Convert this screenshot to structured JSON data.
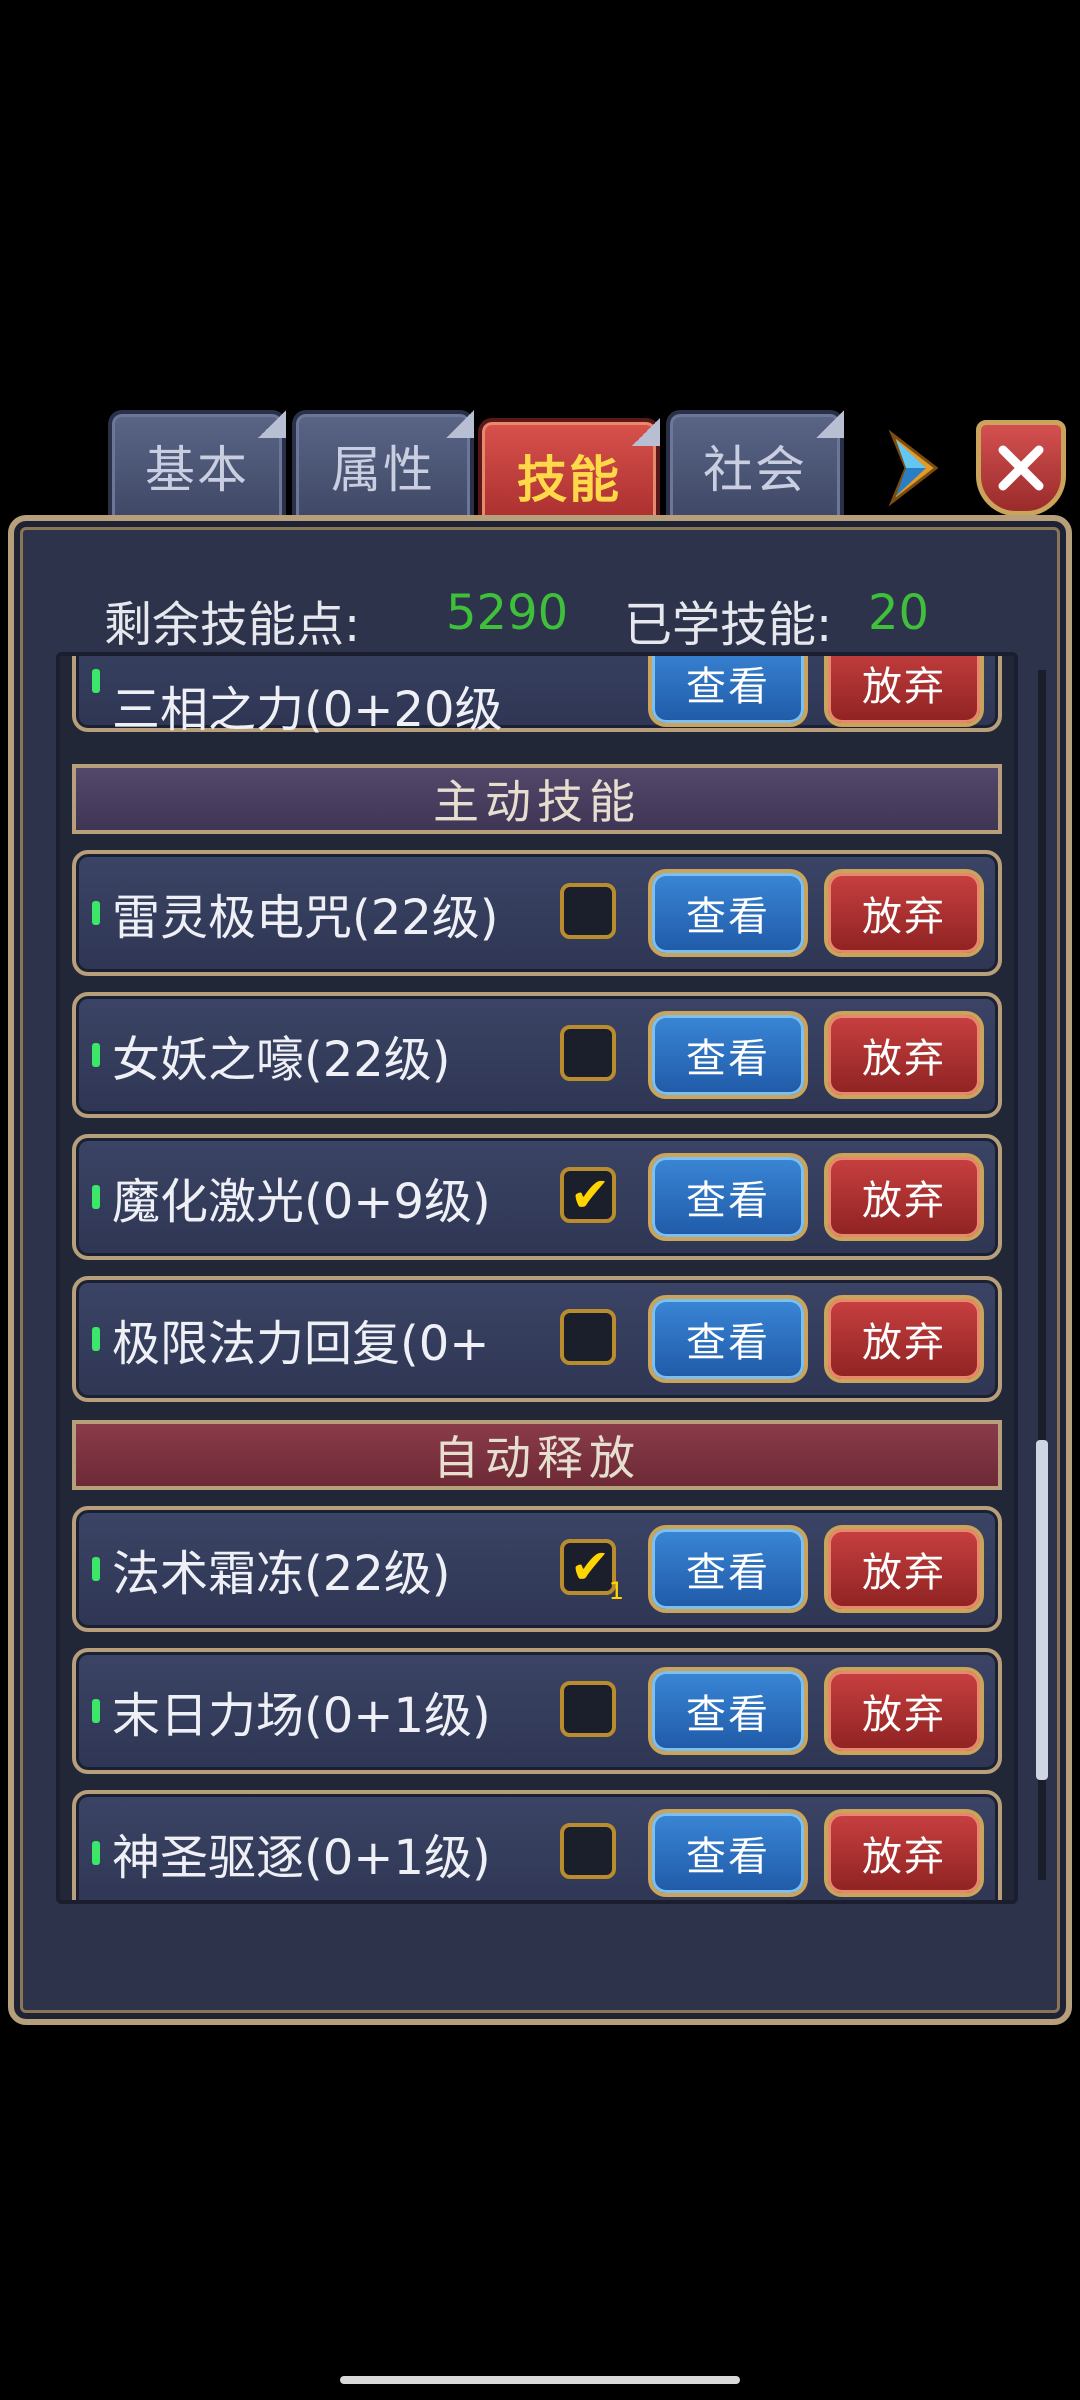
{
  "tabs": [
    {
      "label": "基本",
      "active": false
    },
    {
      "label": "属性",
      "active": false
    },
    {
      "label": "技能",
      "active": true
    },
    {
      "label": "社会",
      "active": false
    }
  ],
  "header": {
    "remaining_label": "剩余技能点:",
    "remaining_value": "5290",
    "learned_label": "已学技能:",
    "learned_value": "20"
  },
  "buttons": {
    "view": "查看",
    "drop": "放弃"
  },
  "sections": {
    "active": "主动技能",
    "auto": "自动释放"
  },
  "skills_top": [
    {
      "name": "三相之力(0+20级",
      "show_check": false
    }
  ],
  "skills_active": [
    {
      "name": "雷灵极电咒(22级)",
      "checked": false
    },
    {
      "name": "女妖之嚎(22级)",
      "checked": false
    },
    {
      "name": "魔化激光(0+9级)",
      "checked": true
    },
    {
      "name": "极限法力回复(0+",
      "checked": false
    }
  ],
  "skills_auto": [
    {
      "name": "法术霜冻(22级)",
      "checked": true,
      "order": "1"
    },
    {
      "name": "末日力场(0+1级)",
      "checked": false
    },
    {
      "name": "神圣驱逐(0+1级)",
      "checked": false
    }
  ],
  "icons": {
    "next": "diamond-arrow-icon",
    "close": "close-icon",
    "check": "checkmark-icon"
  },
  "colors": {
    "accent_green": "#3fbf3a",
    "active_tab": "#c84040",
    "view_button": "#1f5aa8",
    "drop_button": "#8f2222"
  }
}
